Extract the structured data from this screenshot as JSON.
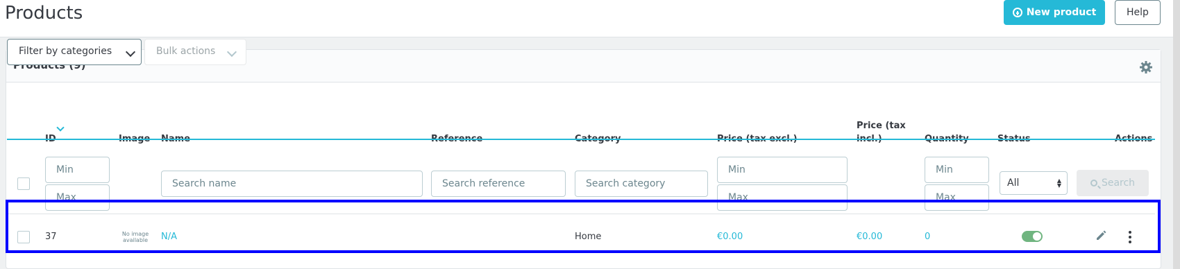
{
  "header": {
    "title": "Products",
    "new_product_label": "New product",
    "help_label": "Help"
  },
  "card": {
    "title": "Products (9)",
    "filter_categories_label": "Filter by categories",
    "bulk_actions_label": "Bulk actions"
  },
  "table": {
    "columns": {
      "id": "ID",
      "image": "Image",
      "name": "Name",
      "reference": "Reference",
      "category": "Category",
      "price_excl": "Price (tax excl.)",
      "price_incl_line1": "Price (tax",
      "price_incl_line2": "incl.)",
      "quantity": "Quantity",
      "status": "Status",
      "actions": "Actions"
    },
    "filters": {
      "id_min_placeholder": "Min",
      "id_max_placeholder": "Max",
      "name_placeholder": "Search name",
      "reference_placeholder": "Search reference",
      "category_placeholder": "Search category",
      "price_min_placeholder": "Min",
      "price_max_placeholder": "Max",
      "qty_min_placeholder": "Min",
      "qty_max_placeholder": "Max",
      "status_selected": "All",
      "search_label": "Search"
    },
    "rows": [
      {
        "id": "37",
        "image_text_line1": "No image",
        "image_text_line2": "available",
        "name": "N/A",
        "reference": "",
        "category": "Home",
        "price_excl": "€0.00",
        "price_incl": "€0.00",
        "quantity": "0",
        "status_enabled": true
      }
    ]
  },
  "colors": {
    "accent": "#25b9d7",
    "status_on": "#70b580",
    "highlight": "#0000ff"
  }
}
